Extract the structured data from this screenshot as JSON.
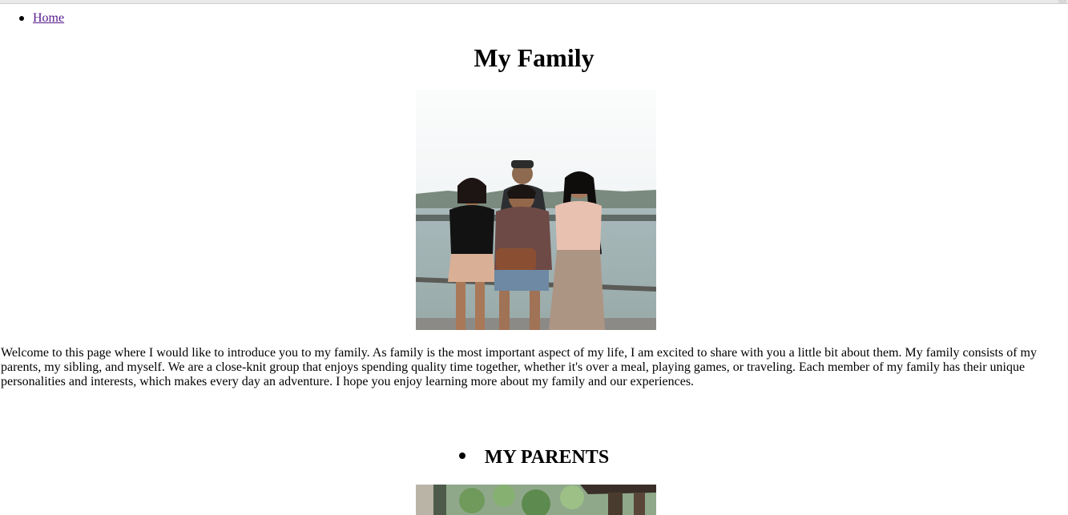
{
  "nav": {
    "items": [
      {
        "label": "Home"
      }
    ]
  },
  "page": {
    "title": "My Family",
    "intro": "Welcome to this page where I would like to introduce you to my family. As family is the most important aspect of my life, I am excited to share with you a little bit about them. My family consists of my parents, my sibling, and myself. We are a close-knit group that enjoys spending quality time together, whether it's over a meal, playing games, or traveling. Each member of my family has their unique personalities and interests, which makes every day an adventure. I hope you enjoy learning more about my family and our experiences."
  },
  "sections": [
    {
      "heading": "MY PARENTS"
    }
  ],
  "colors": {
    "link": "#551a8b",
    "text": "#000000",
    "background": "#ffffff"
  }
}
